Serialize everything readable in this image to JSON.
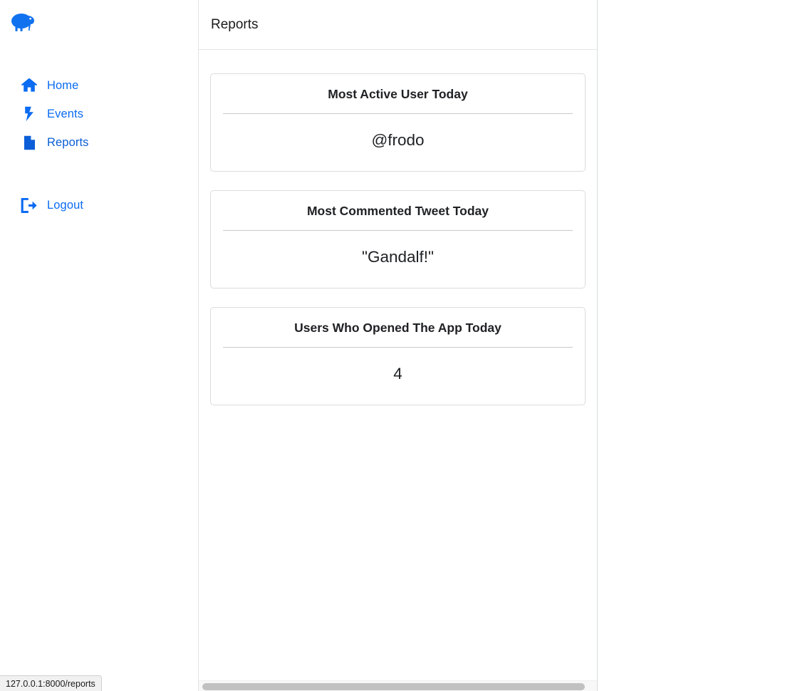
{
  "brand": {
    "logo_icon": "kiwi-bird-icon",
    "logo_color": "#1172ef"
  },
  "sidebar": {
    "items": [
      {
        "label": "Home",
        "icon": "home-icon",
        "active": false
      },
      {
        "label": "Events",
        "icon": "bolt-icon",
        "active": false
      },
      {
        "label": "Reports",
        "icon": "document-icon",
        "active": true
      }
    ],
    "logout": {
      "label": "Logout",
      "icon": "sign-out-icon"
    },
    "link_color": "#0b6bf2",
    "active_color": "#0b5ed7"
  },
  "header": {
    "title": "Reports"
  },
  "cards": [
    {
      "title": "Most Active User Today",
      "value": "@frodo"
    },
    {
      "title": "Most Commented Tweet Today",
      "value": "\"Gandalf!\""
    },
    {
      "title": "Users Who Opened The App Today",
      "value": "4"
    }
  ],
  "status_bar": {
    "url": "127.0.0.1:8000/reports"
  },
  "scrollbar": {
    "orientation": "horizontal",
    "thumb_color": "#c1c1c1",
    "track_color": "#f8f8f8"
  }
}
